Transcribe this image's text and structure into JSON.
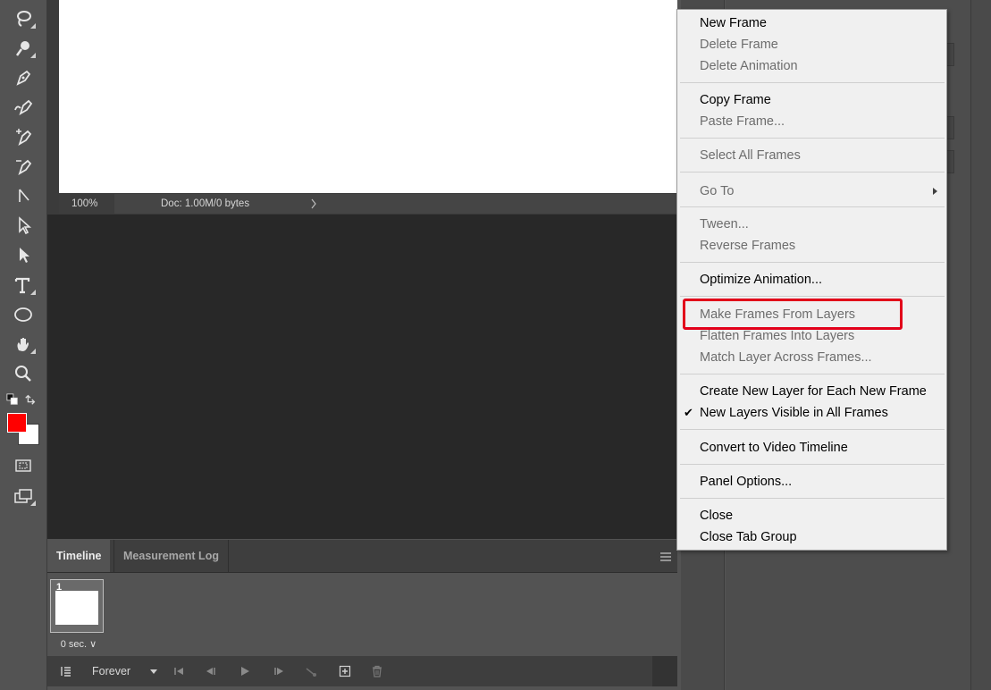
{
  "canvas_status": {
    "zoom": "100%",
    "doc_info": "Doc: 1.00M/0 bytes"
  },
  "toolbar": {
    "tools": [
      "lasso-icon",
      "quick-selection-icon",
      "pen-icon",
      "freeform-pen-icon",
      "add-anchor-point-icon",
      "delete-anchor-point-icon",
      "convert-point-icon",
      "path-selection-icon",
      "direct-selection-icon",
      "type-icon",
      "ellipse-icon",
      "hand-rotate-icon",
      "zoom-icon"
    ],
    "foreground_color": "#ff0000",
    "background_color": "#ffffff"
  },
  "timeline": {
    "tabs": [
      "Timeline",
      "Measurement Log"
    ],
    "frame_number": "1",
    "frame_delay": "0 sec.",
    "loop_option": "Forever"
  },
  "context_menu": {
    "items": [
      {
        "label": "New Frame",
        "enabled": true
      },
      {
        "label": "Delete Frame",
        "enabled": false
      },
      {
        "label": "Delete Animation",
        "enabled": false
      },
      {
        "label": "Copy Frame",
        "enabled": true
      },
      {
        "label": "Paste Frame...",
        "enabled": false
      },
      {
        "label": "Select All Frames",
        "enabled": false
      },
      {
        "label": "Go To",
        "enabled": false,
        "submenu": true
      },
      {
        "label": "Tween...",
        "enabled": false
      },
      {
        "label": "Reverse Frames",
        "enabled": false
      },
      {
        "label": "Optimize Animation...",
        "enabled": true
      },
      {
        "label": "Make Frames From Layers",
        "enabled": false,
        "highlighted": true
      },
      {
        "label": "Flatten Frames Into Layers",
        "enabled": false
      },
      {
        "label": "Match Layer Across Frames...",
        "enabled": false
      },
      {
        "label": "Create New Layer for Each New Frame",
        "enabled": true
      },
      {
        "label": "New Layers Visible in All Frames",
        "enabled": true,
        "checked": true
      },
      {
        "label": "Convert to Video Timeline",
        "enabled": true
      },
      {
        "label": "Panel Options...",
        "enabled": true
      },
      {
        "label": "Close",
        "enabled": true
      },
      {
        "label": "Close Tab Group",
        "enabled": true
      }
    ],
    "highlight_color": "#e2001a"
  }
}
